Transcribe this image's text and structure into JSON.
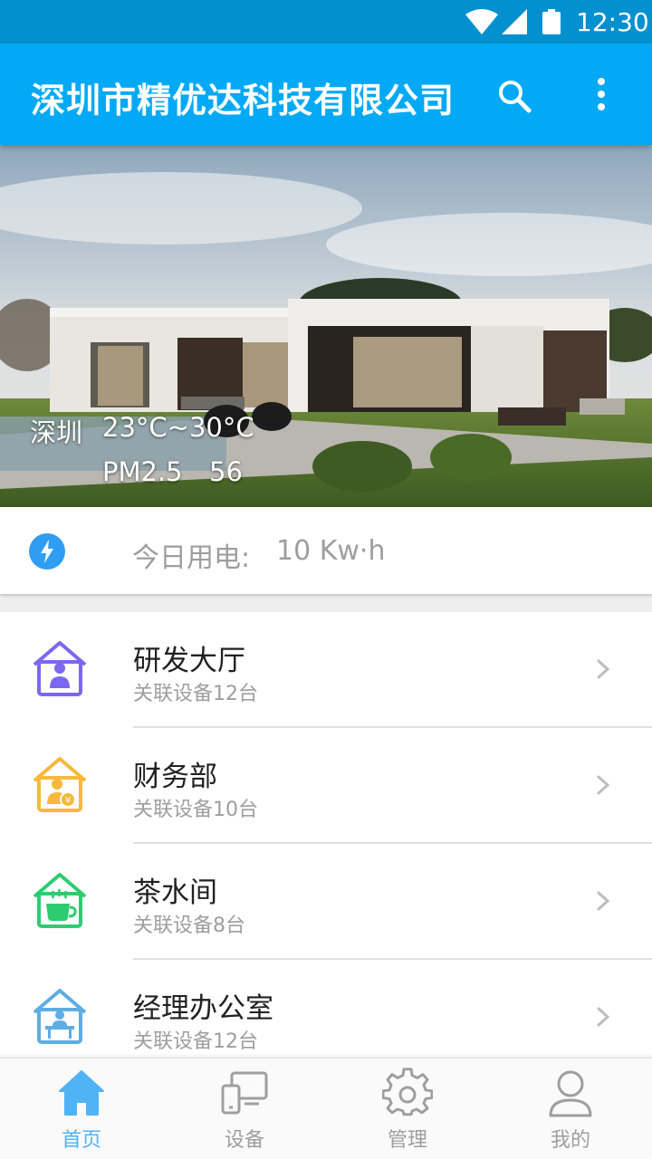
{
  "status_bar": {
    "time": "12:30"
  },
  "app_bar": {
    "title": "深圳市精优达科技有限公司",
    "icons": [
      "search-icon",
      "more-vert-icon"
    ]
  },
  "hero": {
    "city": "深圳",
    "temperature": "23°C~30°C",
    "pm_label": "PM2.5",
    "pm_value": "56"
  },
  "power": {
    "icon": "lightning-icon",
    "label": "今日用电:",
    "value": "10  Kw·h"
  },
  "rooms": [
    {
      "name": "研发大厅",
      "devices": "关联设备12台",
      "icon": "house-person-icon",
      "color": "#7b68ee"
    },
    {
      "name": "财务部",
      "devices": "关联设备10台",
      "icon": "house-finance-icon",
      "color": "#f6b93b"
    },
    {
      "name": "茶水间",
      "devices": "关联设备8台",
      "icon": "house-cup-icon",
      "color": "#2ecc71"
    },
    {
      "name": "经理办公室",
      "devices": "关联设备12台",
      "icon": "house-desk-icon",
      "color": "#5dade2"
    }
  ],
  "bottom_nav": [
    {
      "label": "首页",
      "icon": "home-icon",
      "active": true
    },
    {
      "label": "设备",
      "icon": "devices-icon",
      "active": false
    },
    {
      "label": "管理",
      "icon": "gear-icon",
      "active": false
    },
    {
      "label": "我的",
      "icon": "person-icon",
      "active": false
    }
  ],
  "colors": {
    "status_bar": "#0290cf",
    "app_bar": "#03a9f4",
    "active_nav": "#4fb3f6",
    "inactive": "#9e9e9e"
  }
}
